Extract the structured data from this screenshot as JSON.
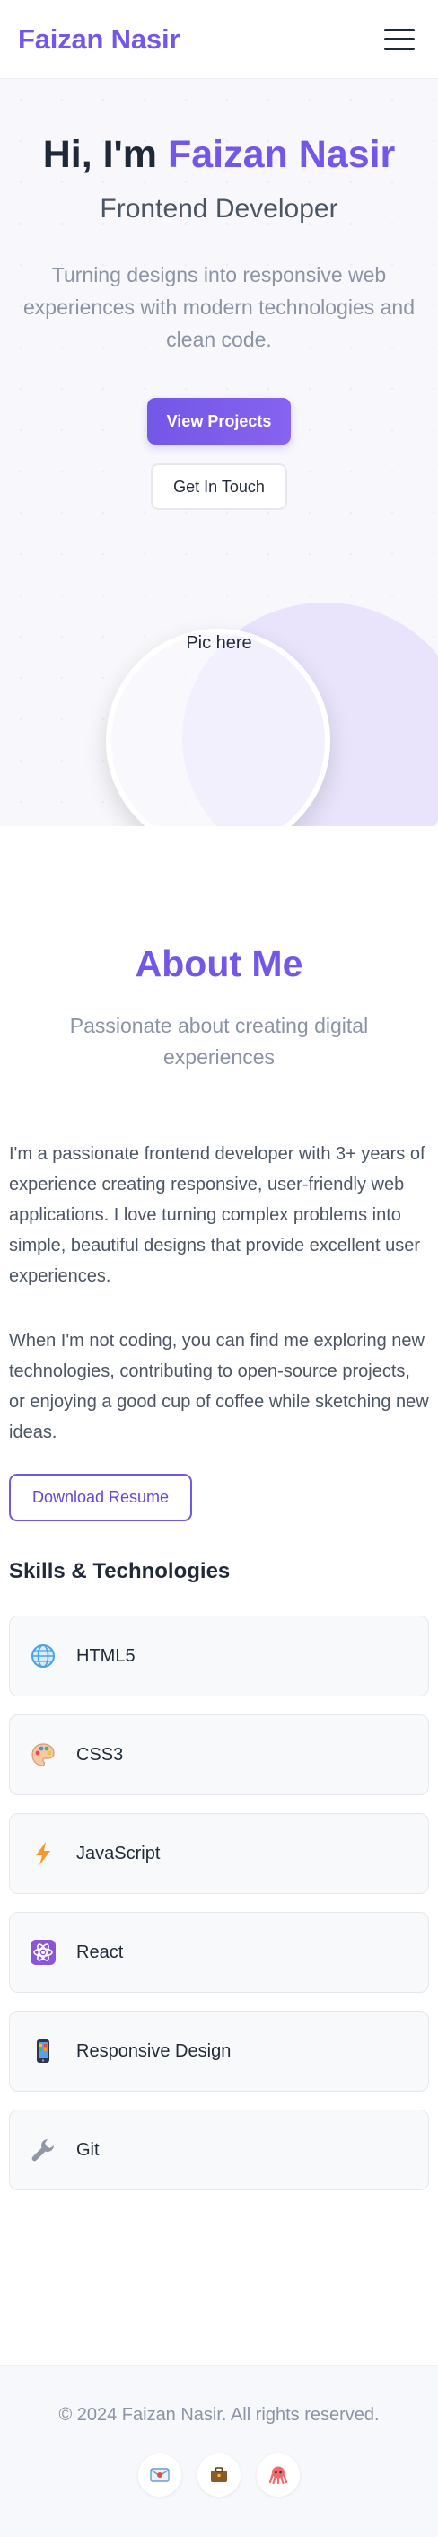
{
  "header": {
    "brand": "Faizan Nasir",
    "menu_icon": "hamburger-menu-icon"
  },
  "hero": {
    "greeting": "Hi, I'm",
    "name": "Faizan Nasir",
    "subtitle": "Frontend Developer",
    "description": "Turning designs into responsive web experiences with modern technologies and clean code.",
    "primary_button": "View Projects",
    "secondary_button": "Get In Touch",
    "picture_placeholder": "Pic here"
  },
  "about": {
    "title": "About Me",
    "lead": "Passionate about creating digital experiences",
    "paragraphs": [
      "I'm a passionate frontend developer with 3+ years of experience creating responsive, user-friendly web applications. I love turning complex problems into simple, beautiful designs that provide excellent user experiences.",
      "When I'm not coding, you can find me exploring new technologies, contributing to open-source projects, or enjoying a good cup of coffee while sketching new ideas."
    ],
    "resume_button": "Download Resume",
    "skills_title": "Skills & Technologies",
    "skills": [
      {
        "label": "HTML5",
        "icon": "globe-icon"
      },
      {
        "label": "CSS3",
        "icon": "palette-icon"
      },
      {
        "label": "JavaScript",
        "icon": "lightning-icon"
      },
      {
        "label": "React",
        "icon": "atom-icon"
      },
      {
        "label": "Responsive Design",
        "icon": "mobile-phone-icon"
      },
      {
        "label": "Git",
        "icon": "wrench-icon"
      }
    ]
  },
  "footer": {
    "copyright": "© 2024 Faizan Nasir. All rights reserved.",
    "socials": [
      {
        "icon": "email-icon"
      },
      {
        "icon": "briefcase-icon"
      },
      {
        "icon": "octopus-icon"
      }
    ]
  },
  "colors": {
    "accent": "#7357e6",
    "text": "#1f2937",
    "muted": "#8a94a6"
  }
}
